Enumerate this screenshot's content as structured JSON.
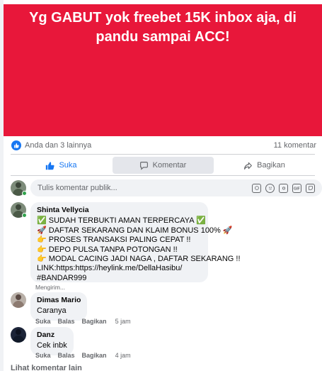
{
  "post": {
    "banner_text": "Yg GABUT yok freebet 15K inbox aja, di pandu sampai ACC!",
    "banner_color": "#e8173a",
    "reactions_text": "Anda dan 3 lainnya",
    "comment_count": "11 komentar"
  },
  "actions": {
    "like": "Suka",
    "comment": "Komentar",
    "share": "Bagikan"
  },
  "composer": {
    "placeholder": "Tulis komentar publik...",
    "tools": [
      "emoji-sticker-icon",
      "smiley-icon",
      "camera-icon",
      "gif-icon",
      "sticker-icon"
    ]
  },
  "comments": [
    {
      "author": "Shinta Vellycia",
      "lines": [
        "✅ SUDAH TERBUKTI AMAN TERPERCAYA ✅",
        "🚀 DAFTAR SEKARANG DAN KLAIM BONUS 100% 🚀",
        "👉 PROSES TRANSAKSI PALING CEPAT !!",
        "👉 DEPO PULSA TANPA POTONGAN !!",
        "👉 MODAL CACING JADI NAGA , DAFTAR SEKARANG !!",
        "LINK:https:https://heylink.me/DellaHasibu/",
        "#BANDAR999"
      ],
      "status": "Mengirim..."
    },
    {
      "author": "Dimas Mario",
      "text": "Caranya",
      "like": "Suka",
      "reply": "Balas",
      "share": "Bagikan",
      "time": "5 jam"
    },
    {
      "author": "Danz",
      "text": "Cek inbk",
      "like": "Suka",
      "reply": "Balas",
      "share": "Bagikan",
      "time": "4 jam"
    }
  ],
  "more_comments": "Lihat komentar lain",
  "colors": {
    "accent": "#1877f2",
    "muted": "#65676b",
    "bubble": "#f0f2f5"
  }
}
